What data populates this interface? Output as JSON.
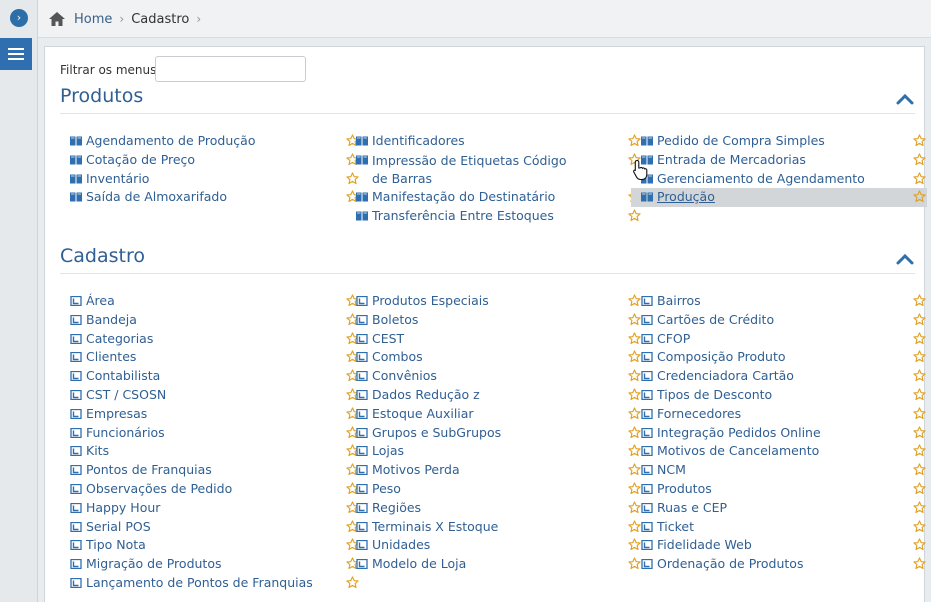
{
  "breadcrumb": {
    "home": "Home",
    "current": "Cadastro"
  },
  "filter": {
    "label": "Filtrar os menus",
    "value": "",
    "placeholder": ""
  },
  "icons": {
    "home": "home-icon",
    "menu": "hamburger-menu-icon",
    "toggle": "chevron-right-circle-icon",
    "collapse": "chevron-up-icon",
    "favorite": "star-outline-icon",
    "item_produtos": "blue-book-icon",
    "item_cadastro": "register-icon"
  },
  "colors": {
    "accent": "#2f6fb0",
    "link": "#2f5f93",
    "star": "#e0a020",
    "hover_bg": "#d3d6d9"
  },
  "sections": [
    {
      "title": "Produtos",
      "columns": [
        [
          "Agendamento de Produção",
          "Cotação de Preço",
          "Inventário",
          "Saída de Almoxarifado"
        ],
        [
          "Identificadores",
          "Impressão de Etiquetas Código de Barras",
          "Manifestação do Destinatário",
          "Transferência Entre Estoques"
        ],
        [
          "Pedido de Compra Simples",
          "Entrada de Mercadorias",
          "Gerenciamento de Agendamento",
          "Produção"
        ]
      ],
      "hovered": "Produção"
    },
    {
      "title": "Cadastro",
      "columns": [
        [
          "Área",
          "Bandeja",
          "Categorias",
          "Clientes",
          "Contabilista",
          "CST / CSOSN",
          "Empresas",
          "Funcionários",
          "Kits",
          "Pontos de Franquias",
          "Observações de Pedido",
          "Happy Hour",
          "Serial POS",
          "Tipo Nota",
          "Migração de Produtos",
          "Lançamento de Pontos de Franquias"
        ],
        [
          "Produtos Especiais",
          "Boletos",
          "CEST",
          "Combos",
          "Convênios",
          "Dados Redução z",
          "Estoque Auxiliar",
          "Grupos e SubGrupos",
          "Lojas",
          "Motivos Perda",
          "Peso",
          "Regiões",
          "Terminais X Estoque",
          "Unidades",
          "Modelo de Loja"
        ],
        [
          "Bairros",
          "Cartões de Crédito",
          "CFOP",
          "Composição Produto",
          "Credenciadora Cartão",
          "Tipos de Desconto",
          "Fornecedores",
          "Integração Pedidos Online",
          "Motivos de Cancelamento",
          "NCM",
          "Produtos",
          "Ruas e CEP",
          "Ticket",
          "Fidelidade Web",
          "Ordenação de Produtos"
        ]
      ]
    }
  ]
}
